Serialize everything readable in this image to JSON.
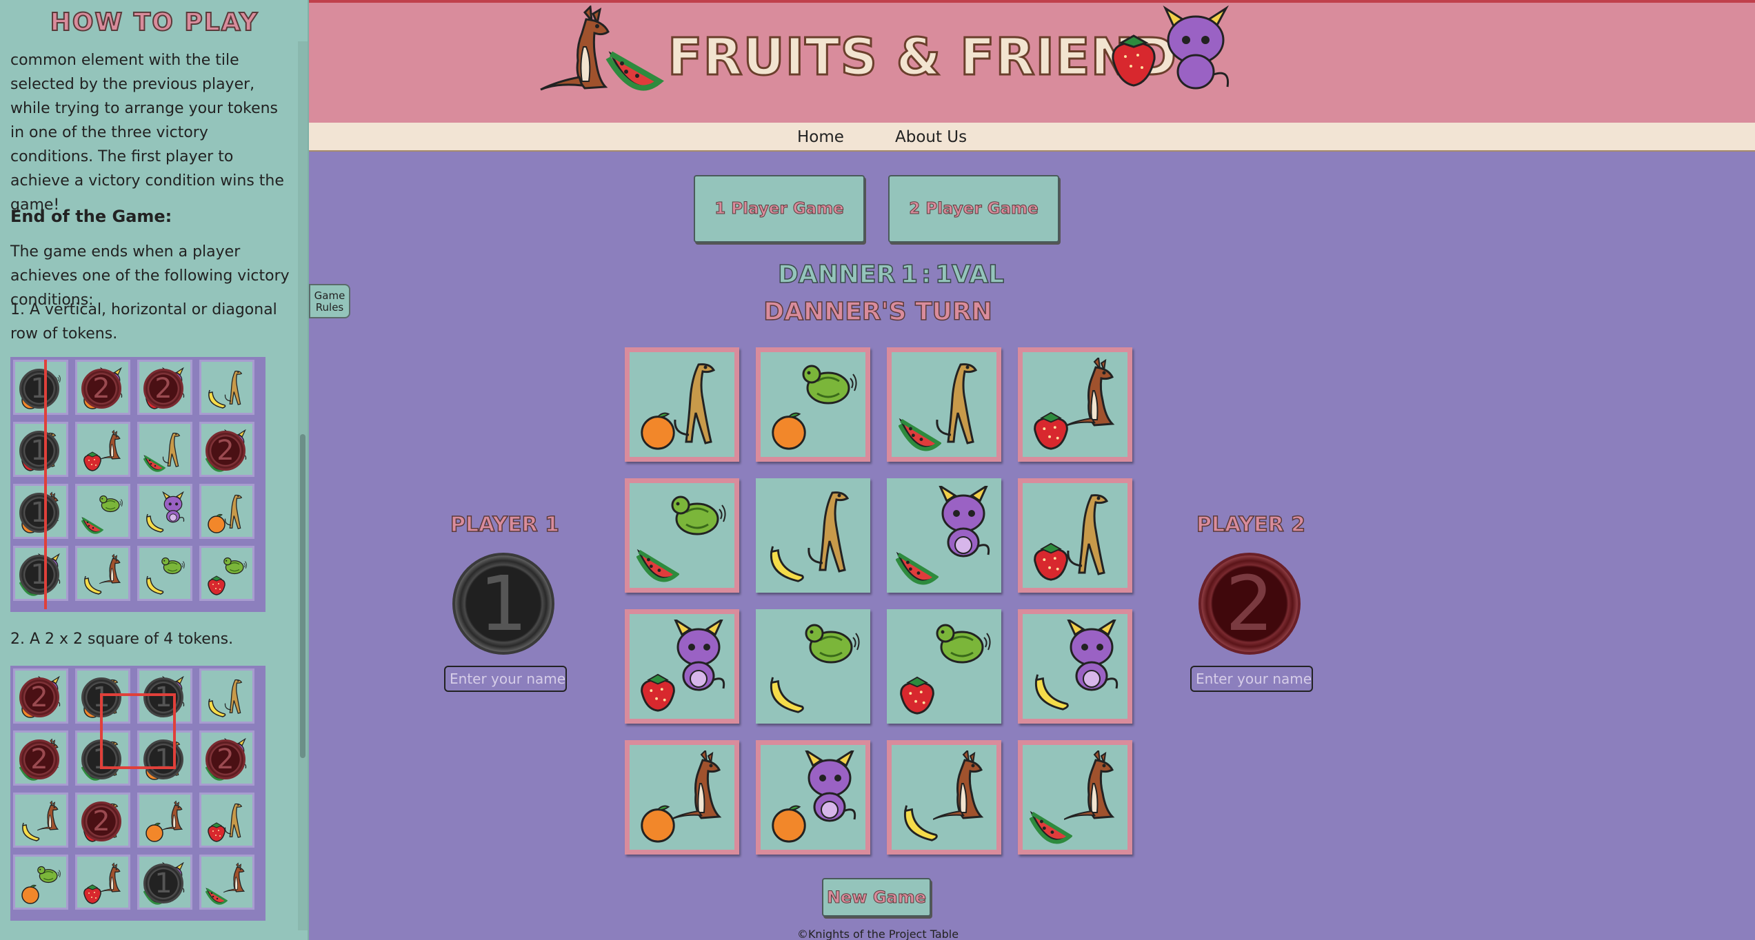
{
  "sidebar": {
    "title": "HOW TO PLAY",
    "paragraph_1": "common element with the tile selected by the previous player, while trying to arrange your tokens in one of the three victory conditions. The first player to achieve a victory condition wins the game!",
    "heading_end": "End of the Game:",
    "paragraph_2": "The game ends when a player achieves one of the following victory conditions:",
    "condition_1": "1. A vertical, horizontal or diagonal row of tokens.",
    "condition_2": "2. A 2 x 2 square of 4 tokens.",
    "token_1_label": "1",
    "token_2_label": "2"
  },
  "game_rules_tab": "Game Rules",
  "header": {
    "title": "FRUITS & FRIENDS"
  },
  "nav": {
    "home": "Home",
    "about": "About Us"
  },
  "modes": {
    "one_player": "1 Player Game",
    "two_player": "2 Player Game"
  },
  "score": {
    "player1_name": "DANNER",
    "player1_score": "1",
    "separator": ":",
    "player2_score": "1",
    "player2_name": "VAL"
  },
  "turn": "DANNER'S TURN",
  "players": {
    "p1": {
      "label": "PLAYER 1",
      "token": "1",
      "name_placeholder": "Enter your name"
    },
    "p2": {
      "label": "PLAYER 2",
      "token": "2",
      "name_placeholder": "Enter your name"
    }
  },
  "board": [
    [
      {
        "fruit": "orange",
        "animal": "greyhound"
      },
      {
        "fruit": "orange",
        "animal": "turtle"
      },
      {
        "fruit": "watermelon",
        "animal": "greyhound"
      },
      {
        "fruit": "strawberry",
        "animal": "kangaroo"
      }
    ],
    [
      {
        "fruit": "watermelon",
        "animal": "turtle"
      },
      {
        "fruit": "banana",
        "animal": "greyhound"
      },
      {
        "fruit": "watermelon",
        "animal": "dragon-cat"
      },
      {
        "fruit": "strawberry",
        "animal": "greyhound"
      }
    ],
    [
      {
        "fruit": "strawberry",
        "animal": "dragon-cat"
      },
      {
        "fruit": "banana",
        "animal": "turtle"
      },
      {
        "fruit": "strawberry",
        "animal": "turtle"
      },
      {
        "fruit": "banana",
        "animal": "dragon-cat"
      }
    ],
    [
      {
        "fruit": "orange",
        "animal": "kangaroo"
      },
      {
        "fruit": "orange",
        "animal": "dragon-cat"
      },
      {
        "fruit": "banana",
        "animal": "kangaroo"
      },
      {
        "fruit": "watermelon",
        "animal": "kangaroo"
      }
    ]
  ],
  "new_game": "New Game",
  "footer": "©Knights of the Project Table",
  "colors": {
    "background": "#8c7fbd",
    "tile": "#94c4bb",
    "accent_pink": "#d98c9c",
    "cream": "#f2e4d4",
    "token_1": "#222222",
    "token_2": "#4a1014"
  }
}
